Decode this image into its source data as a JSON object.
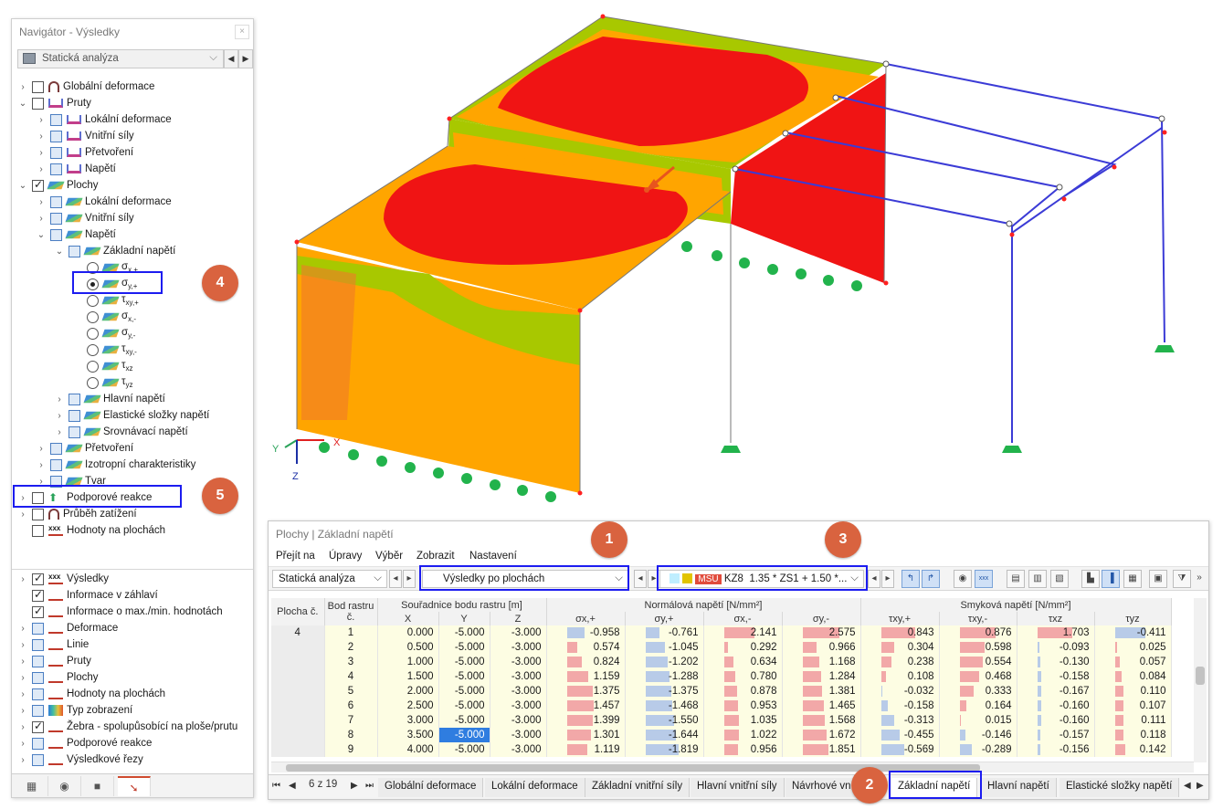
{
  "navigator": {
    "title": "Navigátor - Výsledky",
    "analysis": "Statická analýza",
    "tree": [
      {
        "label": "Globální deformace"
      },
      {
        "label": "Pruty"
      },
      {
        "label": "Lokální deformace"
      },
      {
        "label": "Vnitřní síly"
      },
      {
        "label": "Přetvoření"
      },
      {
        "label": "Napětí"
      },
      {
        "label": "Plochy"
      },
      {
        "label": "Lokální deformace"
      },
      {
        "label": "Vnitřní síly"
      },
      {
        "label": "Napětí"
      },
      {
        "label": "Základní napětí"
      },
      {
        "label": "σ",
        "sub": "x,+"
      },
      {
        "label": "σ",
        "sub": "y,+"
      },
      {
        "label": "τ",
        "sub": "xy,+"
      },
      {
        "label": "σ",
        "sub": "x,-"
      },
      {
        "label": "σ",
        "sub": "y,-"
      },
      {
        "label": "τ",
        "sub": "xy,-"
      },
      {
        "label": "τ",
        "sub": "xz"
      },
      {
        "label": "τ",
        "sub": "yz"
      },
      {
        "label": "Hlavní napětí"
      },
      {
        "label": "Elastické složky napětí"
      },
      {
        "label": "Srovnávací napětí"
      },
      {
        "label": "Přetvoření"
      },
      {
        "label": "Izotropní charakteristiky"
      },
      {
        "label": "Tvar"
      },
      {
        "label": "Podporové reakce"
      },
      {
        "label": "Průběh zatížení"
      },
      {
        "label": "Hodnoty na plochách"
      }
    ],
    "display": [
      {
        "label": "Výsledky"
      },
      {
        "label": "Informace v záhlaví"
      },
      {
        "label": "Informace o max./min. hodnotách"
      },
      {
        "label": "Deformace"
      },
      {
        "label": "Linie"
      },
      {
        "label": "Pruty"
      },
      {
        "label": "Plochy"
      },
      {
        "label": "Hodnoty na plochách"
      },
      {
        "label": "Typ zobrazení"
      },
      {
        "label": "Žebra - spolupůsobící na ploše/prutu"
      },
      {
        "label": "Podporové reakce"
      },
      {
        "label": "Výsledkové řezy"
      }
    ]
  },
  "badges": [
    "1",
    "2",
    "3",
    "4",
    "5"
  ],
  "axes": {
    "x": "X",
    "y": "Y",
    "z": "Z"
  },
  "results": {
    "title": "Plochy | Základní napětí",
    "menu": [
      "Přejít na",
      "Úpravy",
      "Výběr",
      "Zobrazit",
      "Nastavení"
    ],
    "analysis": "Statická analýza",
    "results_by": "Výsledky po plochách",
    "load_tag": "MSÚ",
    "combo_id": "KZ8",
    "combo_formula": "1.35 * ZS1 + 1.50 *...",
    "headers": {
      "plocha": "Plocha č.",
      "bod": "Bod rastru č.",
      "coord_group": "Souřadnice bodu rastru [m]",
      "x": "X",
      "y": "Y",
      "z": "Z",
      "normal_group": "Normálová napětí [N/mm²]",
      "shear_group": "Smyková napětí [N/mm²]",
      "sx_p": "σx,+",
      "sy_p": "σy,+",
      "sx_m": "σx,-",
      "sy_m": "σy,-",
      "txy_p": "τxy,+",
      "txy_m": "τxy,-",
      "txz": "τxz",
      "tyz": "τyz"
    },
    "surface_no": "4",
    "rows": [
      {
        "bod": "1",
        "x": "0.000",
        "y": "-5.000",
        "z": "-3.000",
        "sxp": "-0.958",
        "syp": "-0.761",
        "sxm": "2.141",
        "sym": "2.575",
        "txyp": "0.843",
        "txym": "0.876",
        "txz": "1.703",
        "tyz": "-0.411"
      },
      {
        "bod": "2",
        "x": "0.500",
        "y": "-5.000",
        "z": "-3.000",
        "sxp": "0.574",
        "syp": "-1.045",
        "sxm": "0.292",
        "sym": "0.966",
        "txyp": "0.304",
        "txym": "0.598",
        "txz": "-0.093",
        "tyz": "0.025"
      },
      {
        "bod": "3",
        "x": "1.000",
        "y": "-5.000",
        "z": "-3.000",
        "sxp": "0.824",
        "syp": "-1.202",
        "sxm": "0.634",
        "sym": "1.168",
        "txyp": "0.238",
        "txym": "0.554",
        "txz": "-0.130",
        "tyz": "0.057"
      },
      {
        "bod": "4",
        "x": "1.500",
        "y": "-5.000",
        "z": "-3.000",
        "sxp": "1.159",
        "syp": "-1.288",
        "sxm": "0.780",
        "sym": "1.284",
        "txyp": "0.108",
        "txym": "0.468",
        "txz": "-0.158",
        "tyz": "0.084"
      },
      {
        "bod": "5",
        "x": "2.000",
        "y": "-5.000",
        "z": "-3.000",
        "sxp": "1.375",
        "syp": "-1.375",
        "sxm": "0.878",
        "sym": "1.381",
        "txyp": "-0.032",
        "txym": "0.333",
        "txz": "-0.167",
        "tyz": "0.110"
      },
      {
        "bod": "6",
        "x": "2.500",
        "y": "-5.000",
        "z": "-3.000",
        "sxp": "1.457",
        "syp": "-1.468",
        "sxm": "0.953",
        "sym": "1.465",
        "txyp": "-0.158",
        "txym": "0.164",
        "txz": "-0.160",
        "tyz": "0.107"
      },
      {
        "bod": "7",
        "x": "3.000",
        "y": "-5.000",
        "z": "-3.000",
        "sxp": "1.399",
        "syp": "-1.550",
        "sxm": "1.035",
        "sym": "1.568",
        "txyp": "-0.313",
        "txym": "0.015",
        "txz": "-0.160",
        "tyz": "0.111"
      },
      {
        "bod": "8",
        "x": "3.500",
        "y": "-5.000",
        "z": "-3.000",
        "sxp": "1.301",
        "syp": "-1.644",
        "sxm": "1.022",
        "sym": "1.672",
        "txyp": "-0.455",
        "txym": "-0.146",
        "txz": "-0.157",
        "tyz": "0.118"
      },
      {
        "bod": "9",
        "x": "4.000",
        "y": "-5.000",
        "z": "-3.000",
        "sxp": "1.119",
        "syp": "-1.819",
        "sxm": "0.956",
        "sym": "1.851",
        "txyp": "-0.569",
        "txym": "-0.289",
        "txz": "-0.156",
        "tyz": "0.142"
      }
    ],
    "page": "6 z 19",
    "sheet_tabs": [
      "Globální deformace",
      "Lokální deformace",
      "Základní vnitřní síly",
      "Hlavní vnitřní síly",
      "Návrhové vn",
      "Základní napětí",
      "Hlavní napětí",
      "Elastické složky napětí"
    ],
    "active_tab": "Základní napětí"
  },
  "colors": {
    "red": "#f01414",
    "orange": "#ffa500",
    "green": "#a8c800",
    "highlight": "#1c1cf0",
    "badge": "#d9633f"
  }
}
